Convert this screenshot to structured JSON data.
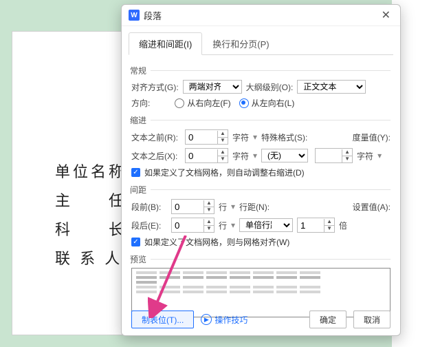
{
  "window": {
    "title": "段落"
  },
  "tabs": {
    "indent": "缩进和间距(I)",
    "pagination": "换行和分页(P)"
  },
  "groups": {
    "general": "常规",
    "indent": "缩进",
    "spacing": "间距",
    "preview": "预览"
  },
  "general": {
    "align_label": "对齐方式(G):",
    "align_value": "两端对齐",
    "outline_label": "大纲级别(O):",
    "outline_value": "正文文本",
    "direction_label": "方向:",
    "rtl_label": "从右向左(F)",
    "ltr_label": "从左向右(L)"
  },
  "indent": {
    "before_label": "文本之前(R):",
    "before_value": "0",
    "unit_char": "字符",
    "special_label": "特殊格式(S):",
    "measure_label": "度量值(Y):",
    "after_label": "文本之后(X):",
    "after_value": "0",
    "special_value": "(无)",
    "auto_label": "如果定义了文档网格，则自动调整右缩进(D)"
  },
  "spacing": {
    "before_label": "段前(B):",
    "before_value": "0",
    "unit_line": "行",
    "linespacing_label": "行距(N):",
    "setvalue_label": "设置值(A):",
    "after_label": "段后(E):",
    "after_value": "0",
    "linespacing_value": "单倍行距",
    "setvalue_value": "1",
    "unit_bei": "倍",
    "snap_label": "如果定义了文档网格，则与网格对齐(W)"
  },
  "footer": {
    "tabs_btn": "制表位(T)...",
    "tips": "操作技巧",
    "ok": "确定",
    "cancel": "取消"
  },
  "doc_rows": [
    "单位名称",
    "主　　任",
    "科　　长",
    "联 系 人"
  ]
}
